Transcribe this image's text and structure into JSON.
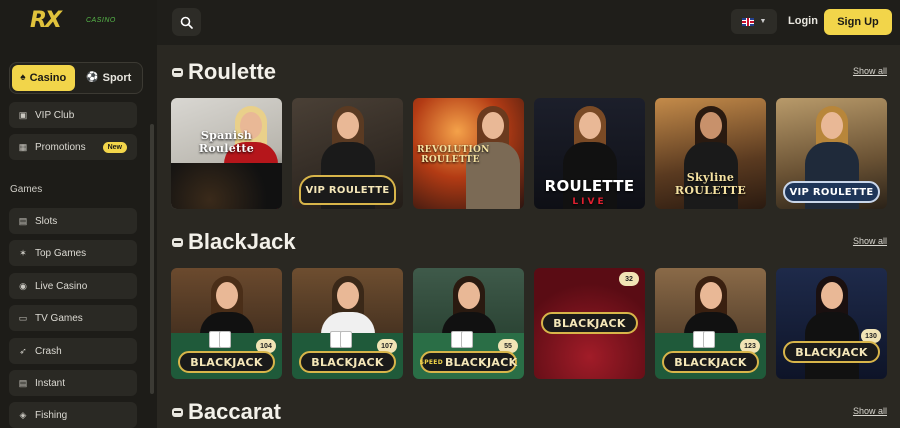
{
  "brand": {
    "logo_text": "RX",
    "logo_sub": "CASINO"
  },
  "sidebar": {
    "mode": {
      "casino_label": "Casino",
      "sport_label": "Sport",
      "active": "casino"
    },
    "items": [
      {
        "label": "VIP Club",
        "icon": "vip-icon"
      },
      {
        "label": "Promotions",
        "icon": "gift-icon",
        "badge": "New"
      }
    ],
    "games_label": "Games",
    "game_items": [
      {
        "label": "Slots",
        "icon": "slots-icon"
      },
      {
        "label": "Top Games",
        "icon": "star-icon"
      },
      {
        "label": "Live Casino",
        "icon": "live-icon"
      },
      {
        "label": "TV Games",
        "icon": "tv-icon"
      },
      {
        "label": "Crash",
        "icon": "rocket-icon"
      },
      {
        "label": "Instant",
        "icon": "instant-icon"
      },
      {
        "label": "Fishing",
        "icon": "fish-icon"
      }
    ]
  },
  "header": {
    "login_label": "Login",
    "signup_label": "Sign Up",
    "language": "EN",
    "colors": {
      "accent": "#f2d54a",
      "bg": "#2a2822"
    }
  },
  "sections": [
    {
      "title": "Roulette",
      "show_all": "Show all",
      "games": [
        {
          "label": "Spanish Roulette"
        },
        {
          "label": "VIP ROULETTE"
        },
        {
          "label": "REVOLUTION ROULETTE"
        },
        {
          "label": "ROULETTE",
          "sub": "LIVE"
        },
        {
          "label": "Skyline ROULETTE"
        },
        {
          "label": "VIP ROULETTE"
        }
      ]
    },
    {
      "title": "BlackJack",
      "show_all": "Show all",
      "games": [
        {
          "label": "BLACKJACK",
          "num": "104"
        },
        {
          "label": "BLACKJACK",
          "num": "107"
        },
        {
          "label": "BLACKJACK",
          "num": "55",
          "pre": "SPEED"
        },
        {
          "label": "BLACKJACK",
          "num": "32"
        },
        {
          "label": "BLACKJACK",
          "num": "123"
        },
        {
          "label": "BLACKJACK",
          "num": "130"
        }
      ]
    },
    {
      "title": "Baccarat",
      "show_all": "Show all"
    }
  ]
}
